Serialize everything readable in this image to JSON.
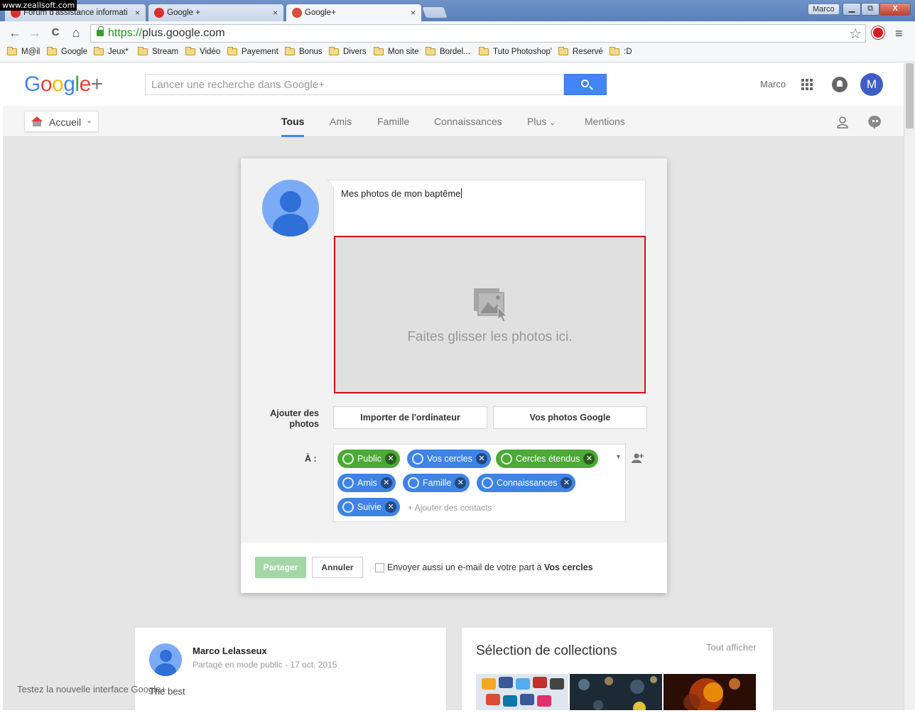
{
  "watermark": "www.zeallsoft.com",
  "browser": {
    "tabs": [
      {
        "title": "Forum d'assistance informati",
        "icon_color": "#d9302a",
        "active": false
      },
      {
        "title": "Google +",
        "icon_color": "#d9302a",
        "active": false
      },
      {
        "title": "Google+",
        "icon_color": "#dd4b39",
        "active": true
      }
    ],
    "tab_close_glyph": "×",
    "user_chip": "Marco",
    "window_controls": {
      "minimize": "▁",
      "restore": "⧉",
      "close": "X"
    },
    "nav": {
      "back": "←",
      "forward": "→",
      "reload": "C",
      "home": "⌂"
    },
    "url_scheme": "https://",
    "url_host": "plus.google.com",
    "star_icon": "☆",
    "menu_icon": "≡",
    "bookmarks": [
      "M@il",
      "Google",
      "Jeux*",
      "Stream",
      "Vidéo",
      "Payement",
      "Bonus",
      "Divers",
      "Mon site",
      "Bordel...",
      "Tuto Photoshop'",
      "Reservé",
      ":D"
    ]
  },
  "header": {
    "logo": [
      "G",
      "o",
      "o",
      "g",
      "l",
      "e",
      "+"
    ],
    "search_placeholder": "Lancer une recherche dans Google+",
    "user_name": "Marco",
    "avatar_letter": "M"
  },
  "subnav": {
    "home_label": "Accueil",
    "home_chevron": "⌄",
    "tabs": [
      "Tous",
      "Amis",
      "Famille",
      "Connaissances",
      "Plus",
      "Mentions"
    ],
    "plus_chevron": "⌄",
    "accent": "#4285f4"
  },
  "dialog": {
    "compose_text": "Mes photos de mon baptême",
    "dropzone_text": "Faites glisser les photos ici.",
    "dropzone_border": "#d40f17",
    "add_photos_label": "Ajouter des photos",
    "import_button": "Importer de l'ordinateur",
    "google_photos_button": "Vos photos Google",
    "to_label": "À :",
    "chips": [
      {
        "label": "Public",
        "color": "green"
      },
      {
        "label": "Vos cercles",
        "color": "blue"
      },
      {
        "label": "Cercles étendus",
        "color": "green"
      },
      {
        "label": "Amis",
        "color": "blue"
      },
      {
        "label": "Famille",
        "color": "blue"
      },
      {
        "label": "Connaissances",
        "color": "blue"
      },
      {
        "label": "Suivie",
        "color": "blue"
      }
    ],
    "chip_remove_glyph": "✕",
    "add_contacts": "+ Ajouter des contacts",
    "share_button": "Partager",
    "cancel_button": "Annuler",
    "email_prefix": "Envoyer aussi un e-mail de votre part à",
    "email_target": "Vos cercles"
  },
  "post": {
    "author": "Marco Lelasseux",
    "meta": "Partagé en mode public  -  17 oct. 2015",
    "body": "The best"
  },
  "collections": {
    "title": "Sélection de collections",
    "see_all": "Tout afficher"
  },
  "toast": "Testez la nouvelle interface Google+"
}
